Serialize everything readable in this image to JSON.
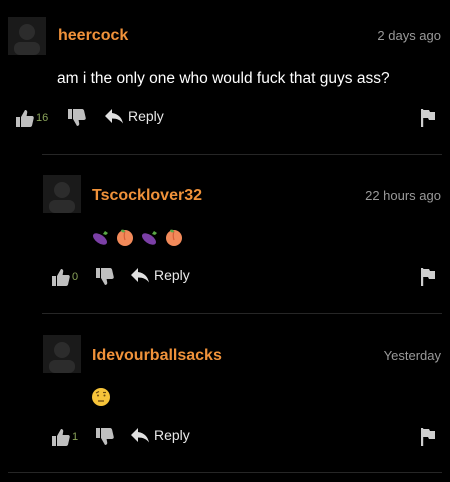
{
  "comments": [
    {
      "username": "heercock",
      "timestamp": "2 days ago",
      "text": "am i the only one who would fuck that guys ass?",
      "emojis": [],
      "likes": "16",
      "reply_label": "Reply"
    },
    {
      "username": "Tscocklover32",
      "timestamp": "22 hours ago",
      "text": "",
      "emojis": [
        "eggplant",
        "peach",
        "eggplant",
        "peach"
      ],
      "likes": "0",
      "reply_label": "Reply"
    },
    {
      "username": "Idevourballsacks",
      "timestamp": "Yesterday",
      "text": "",
      "emojis": [
        "face-with-raised-eyebrow"
      ],
      "likes": "1",
      "reply_label": "Reply"
    }
  ],
  "colors": {
    "username": "#f0923a",
    "timestamp": "#9a9a9a",
    "like_count": "#8aa35a",
    "background": "#000000"
  }
}
